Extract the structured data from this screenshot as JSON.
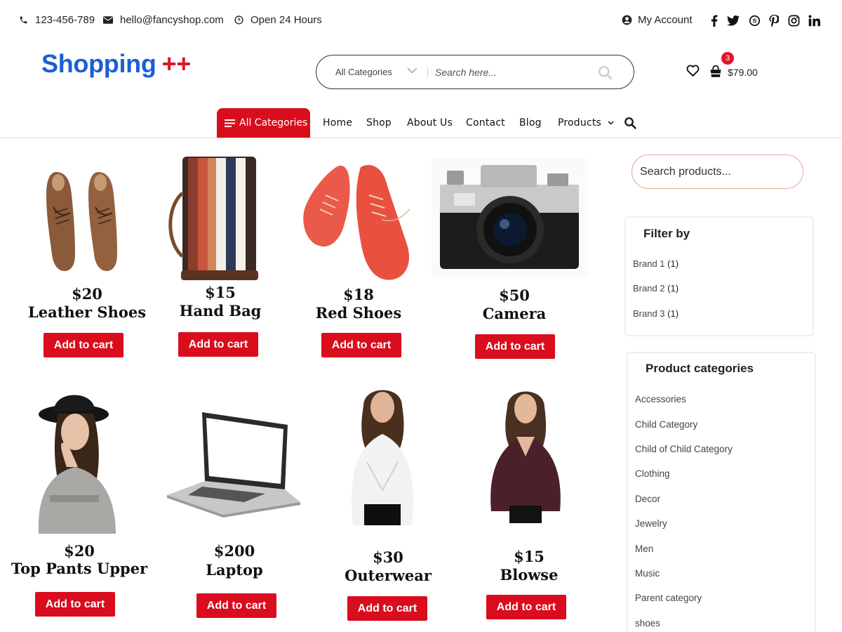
{
  "topbar": {
    "phone": "123-456-789",
    "email": "hello@fancyshop.com",
    "hours": "Open 24 Hours",
    "account": "My Account",
    "social_icons": [
      "facebook-icon",
      "twitter-icon",
      "skype-icon",
      "pinterest-icon",
      "instagram-icon",
      "linkedin-icon"
    ]
  },
  "logo": {
    "part1": "Shopping",
    "part2": "++"
  },
  "search": {
    "category": "All Categories",
    "placeholder": "Search here..."
  },
  "cart": {
    "count": "3",
    "total": "$79.00"
  },
  "nav": {
    "all_categories": "All Categories",
    "links": [
      "Home",
      "Shop",
      "About Us",
      "Contact",
      "Blog",
      "Products"
    ]
  },
  "products": [
    {
      "price": "$20",
      "name": "Leather Shoes",
      "button": "Add to cart"
    },
    {
      "price": "$15",
      "name": "Hand Bag",
      "button": "Add to cart"
    },
    {
      "price": "$18",
      "name": "Red Shoes",
      "button": "Add to cart"
    },
    {
      "price": "$50",
      "name": "Camera",
      "button": "Add to cart"
    },
    {
      "price": "$20",
      "name": "Top Pants Upper",
      "button": "Add to cart"
    },
    {
      "price": "$200",
      "name": "Laptop",
      "button": "Add to cart"
    },
    {
      "price": "$30",
      "name": "Outerwear",
      "button": "Add to cart"
    },
    {
      "price": "$15",
      "name": "Blowse",
      "button": "Add to cart"
    }
  ],
  "sidebar": {
    "search_placeholder": "Search products...",
    "filter": {
      "title": "Filter by",
      "brands": [
        {
          "name": "Brand 1",
          "count": "(1)"
        },
        {
          "name": "Brand 2",
          "count": "(1)"
        },
        {
          "name": "Brand 3",
          "count": "(1)"
        }
      ]
    },
    "categories": {
      "title": "Product categories",
      "items": [
        "Accessories",
        "Child Category",
        "Child of Child Category",
        "Clothing",
        "Decor",
        "Jewelry",
        "Men",
        "Music",
        "Parent category",
        "shoes"
      ]
    }
  },
  "colors": {
    "accent": "#d90d1d",
    "logo_blue": "#1a5fd6",
    "logo_red": "#e0162b"
  }
}
